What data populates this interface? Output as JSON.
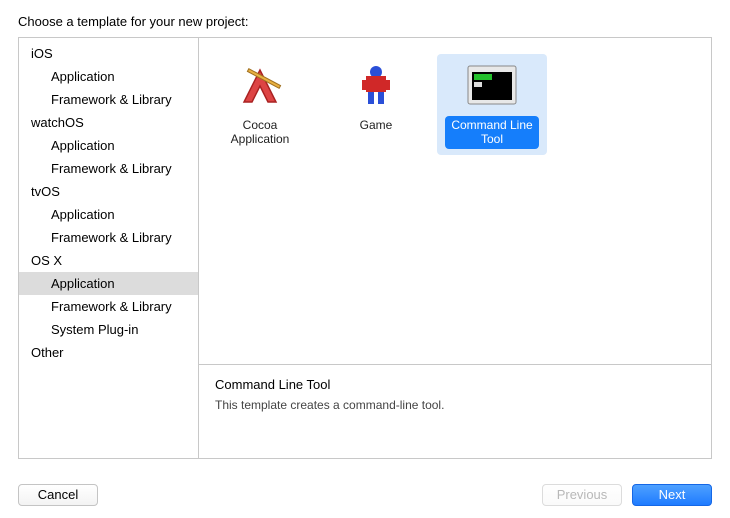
{
  "header": "Choose a template for your new project:",
  "sidebar": {
    "groups": [
      {
        "name": "iOS",
        "items": [
          "Application",
          "Framework & Library"
        ]
      },
      {
        "name": "watchOS",
        "items": [
          "Application",
          "Framework & Library"
        ]
      },
      {
        "name": "tvOS",
        "items": [
          "Application",
          "Framework & Library"
        ]
      },
      {
        "name": "OS X",
        "items": [
          "Application",
          "Framework & Library",
          "System Plug-in"
        ]
      },
      {
        "name": "Other",
        "items": []
      }
    ],
    "selected": {
      "group": "OS X",
      "item": "Application"
    }
  },
  "templates": [
    {
      "id": "cocoa-app",
      "label": "Cocoa\nApplication",
      "icon": "pencil-a"
    },
    {
      "id": "game",
      "label": "Game",
      "icon": "sprite"
    },
    {
      "id": "cmdline",
      "label": "Command Line\nTool",
      "icon": "terminal",
      "selected": true
    }
  ],
  "description": {
    "title": "Command Line Tool",
    "text": "This template creates a command-line tool."
  },
  "buttons": {
    "cancel": "Cancel",
    "previous": "Previous",
    "next": "Next"
  },
  "colors": {
    "selection_bg": "#d9e9fb",
    "selection_label": "#157efb",
    "primary_btn": "#1f7bff"
  }
}
